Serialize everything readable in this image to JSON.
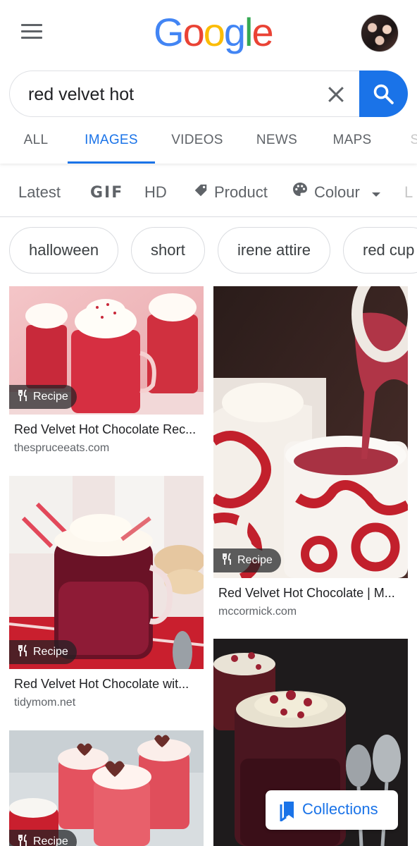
{
  "app": {
    "logo_text": "Google"
  },
  "search": {
    "query": "red velvet hot",
    "placeholder": ""
  },
  "tabs": [
    {
      "label": "ALL",
      "active": false
    },
    {
      "label": "IMAGES",
      "active": true
    },
    {
      "label": "VIDEOS",
      "active": false
    },
    {
      "label": "NEWS",
      "active": false
    },
    {
      "label": "MAPS",
      "active": false
    },
    {
      "label": "S",
      "active": false
    }
  ],
  "filters": [
    {
      "label": "Latest",
      "icon": ""
    },
    {
      "label": "GIF",
      "icon": "gif-icon"
    },
    {
      "label": "HD",
      "icon": ""
    },
    {
      "label": "Product",
      "icon": "tag-icon"
    },
    {
      "label": "Colour",
      "icon": "palette-icon"
    },
    {
      "label": "L",
      "icon": ""
    }
  ],
  "chips": [
    "halloween",
    "short",
    "irene attire",
    "red cup"
  ],
  "results": [
    {
      "badge": "Recipe",
      "title": "Red Velvet Hot Chocolate Rec...",
      "source": "thespruceeats.com"
    },
    {
      "badge": "Recipe",
      "title": "Red Velvet Hot Chocolate | M...",
      "source": "mccormick.com"
    },
    {
      "badge": "Recipe",
      "title": "Red Velvet Hot Chocolate wit...",
      "source": "tidymom.net"
    },
    {
      "badge": "",
      "title": "",
      "source": ""
    },
    {
      "badge": "Recipe",
      "title": "",
      "source": ""
    }
  ],
  "collections": {
    "label": "Collections"
  },
  "colors": {
    "accent": "#1a73e8",
    "text": "#202124",
    "muted": "#5f6368",
    "border": "#dadce0"
  }
}
